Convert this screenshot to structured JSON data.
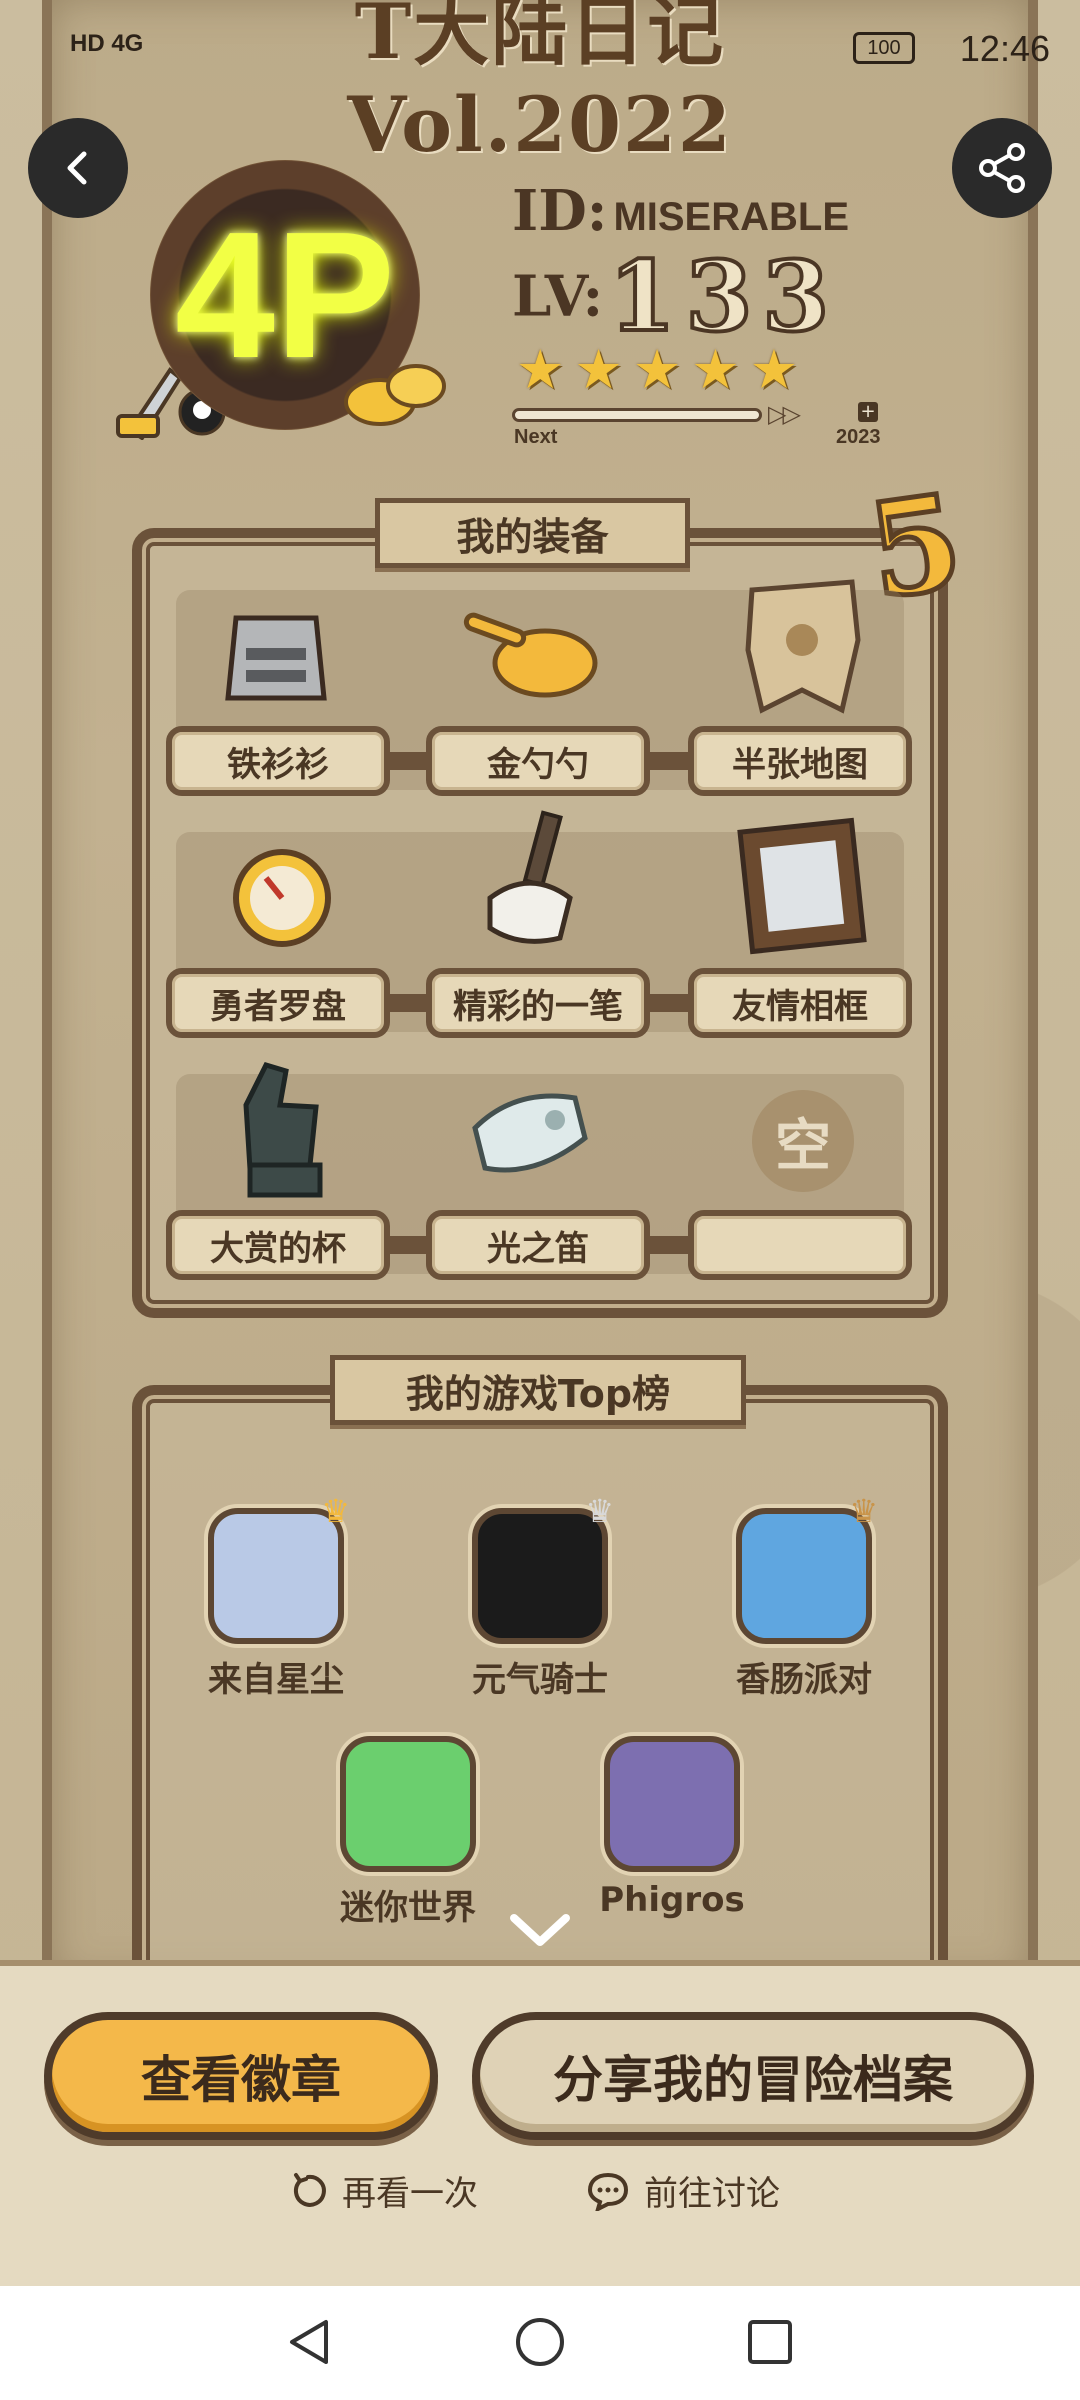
{
  "status_bar": {
    "network": "HD 4G",
    "battery": "100",
    "time": "12:46"
  },
  "header": {
    "title": "T大陆日记 Vol.2022"
  },
  "profile": {
    "badge_number": "4P",
    "id_label": "ID:",
    "id_value": "MISERABLE",
    "lv_label": "LV:",
    "lv_value": "133",
    "stars": 5,
    "progress_fraction": 0.0,
    "next_label": "Next",
    "year_label": "2023",
    "equipment_count": "5"
  },
  "equipment": {
    "title": "我的装备",
    "items": [
      {
        "name": "铁衫衫",
        "icon": "armor-icon"
      },
      {
        "name": "金勺勺",
        "icon": "golden-spoon-icon"
      },
      {
        "name": "半张地图",
        "icon": "torn-map-icon"
      },
      {
        "name": "勇者罗盘",
        "icon": "compass-icon"
      },
      {
        "name": "精彩的一笔",
        "icon": "brush-icon"
      },
      {
        "name": "友情相框",
        "icon": "photo-frame-icon"
      },
      {
        "name": "大赏的杯",
        "icon": "thumbs-up-trophy-icon"
      },
      {
        "name": "光之笛",
        "icon": "whistle-icon"
      },
      {
        "name": "",
        "icon": "empty-slot-icon"
      }
    ],
    "empty_label": "空"
  },
  "top_games": {
    "title": "我的游戏Top榜",
    "games": [
      {
        "name": "来自星尘",
        "color": "#b9c9e6"
      },
      {
        "name": "元气骑士",
        "color": "#1b1b1b"
      },
      {
        "name": "香肠派对",
        "color": "#5fa6e0"
      },
      {
        "name": "迷你世界",
        "color": "#6bcf6e"
      },
      {
        "name": "Phigros",
        "color": "#7d6fb0"
      }
    ]
  },
  "actions": {
    "view_badge": "查看徽章",
    "share_profile": "分享我的冒险档案",
    "replay": "再看一次",
    "discuss": "前往讨论"
  }
}
